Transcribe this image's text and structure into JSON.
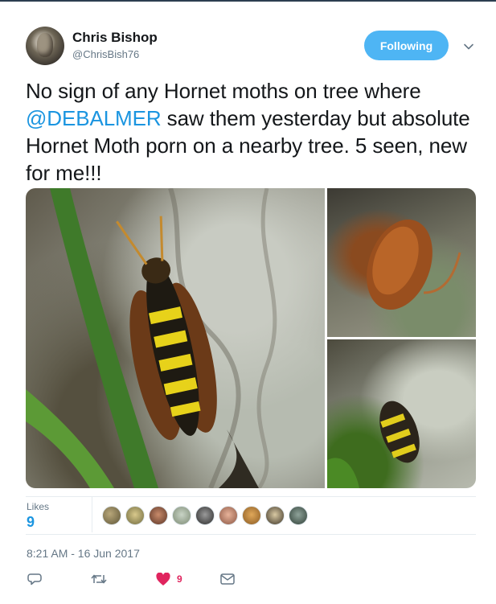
{
  "user": {
    "name": "Chris Bishop",
    "handle": "@ChrisBish76",
    "follow_label": "Following"
  },
  "tweet": {
    "text_before": "No sign of any Hornet moths on tree where ",
    "mention": "@DEBALMER",
    "text_after": " saw them yesterday but absolute Hornet Moth porn on a nearby tree. 5 seen, new for me!!!"
  },
  "stats": {
    "likes_label": "Likes",
    "likes_count": "9"
  },
  "timestamp": "8:21 AM - 16 Jun 2017",
  "actions": {
    "like_count": "9"
  },
  "colors": {
    "accent": "#1da1f2",
    "mention": "#1b95e0",
    "like": "#e0245e",
    "muted": "#657786"
  },
  "icons": {
    "caret": "chevron-down-icon",
    "reply": "reply-icon",
    "retweet": "retweet-icon",
    "like": "heart-icon",
    "dm": "envelope-icon"
  }
}
